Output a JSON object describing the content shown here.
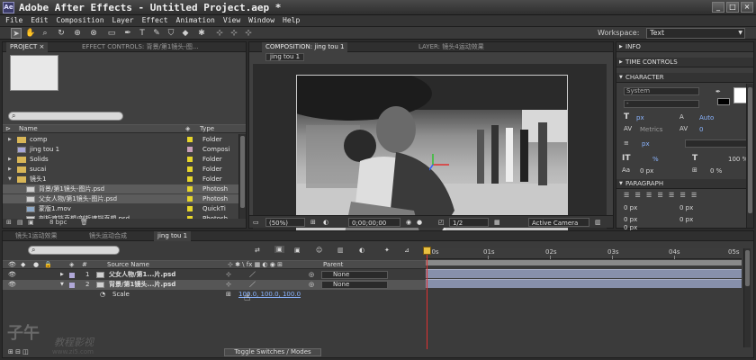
{
  "window": {
    "app_icon_text": "Ae",
    "title": "Adobe After Effects - Untitled Project.aep *",
    "controls": [
      "_",
      "□",
      "×"
    ]
  },
  "menu": [
    "File",
    "Edit",
    "Composition",
    "Layer",
    "Effect",
    "Animation",
    "View",
    "Window",
    "Help"
  ],
  "toolbar": {
    "tools": [
      "selection-tool",
      "hand-tool",
      "zoom-tool",
      "rotation-tool",
      "orbit-camera-tool",
      "pan-behind-tool",
      "rectangle-mask-tool",
      "pen-tool",
      "type-tool",
      "brush-tool",
      "clone-stamp-tool",
      "eraser-tool",
      "puppet-pin-tool",
      "local-axis-mode",
      "world-axis-mode",
      "view-axis-mode"
    ],
    "workspace_label": "Workspace:",
    "workspace_value": "Text"
  },
  "project_panel": {
    "tabs": [
      "PROJECT ×",
      "EFFECT CONTROLS: 背景/第1镜头-图..."
    ],
    "columns": {
      "name": "Name",
      "type": "Type"
    },
    "items": [
      {
        "name": "comp",
        "type": "Folder",
        "icon": "folder",
        "indent": 0,
        "expanded": false
      },
      {
        "name": "jing tou 1",
        "type": "Composi",
        "icon": "comp",
        "indent": 0,
        "expanded": null
      },
      {
        "name": "Solids",
        "type": "Folder",
        "icon": "folder",
        "indent": 0,
        "expanded": false
      },
      {
        "name": "sucai",
        "type": "Folder",
        "icon": "folder",
        "indent": 0,
        "expanded": false
      },
      {
        "name": "镜头1",
        "type": "Folder",
        "icon": "folder",
        "indent": 0,
        "expanded": true
      },
      {
        "name": "背景/第1镜头-图片.psd",
        "type": "Photosh",
        "icon": "psd",
        "indent": 1,
        "expanded": null
      },
      {
        "name": "父女人物/第1镜头-图片.psd",
        "type": "Photosh",
        "icon": "psd",
        "indent": 1,
        "expanded": null
      },
      {
        "name": "蒙版1.mov",
        "type": "QuickTi",
        "icon": "mov",
        "indent": 1,
        "expanded": null
      },
      {
        "name": "剖析遮挡直想/剖析遮挡直想.psd",
        "type": "Photosh",
        "icon": "psd",
        "indent": 1,
        "expanded": null
      }
    ],
    "footer_bpc": "8 bpc"
  },
  "composition_panel": {
    "tabs": [
      "COMPOSITION: jing tou 1",
      "LAYER: 镜头4运动效果"
    ],
    "comp_tab": "jing tou 1",
    "zoom": "(50%)",
    "timecode": "0;00;00;00",
    "resolution": "1/2",
    "camera": "Active Camera"
  },
  "right_panels": {
    "info": "INFO",
    "time_controls": "TIME CONTROLS",
    "character": {
      "title": "CHARACTER",
      "font": "System",
      "style": "-",
      "size_unit": "px",
      "leading_auto": "Auto",
      "metrics": "Metrics",
      "tracking": "0",
      "stroke_unit": "px",
      "vscale": "%",
      "hscale": "100 %",
      "baseline": "0 px",
      "tsume": "0 %"
    },
    "paragraph": {
      "title": "PARAGRAPH",
      "indents": [
        "0 px",
        "0 px",
        "0 px",
        "0 px",
        "0 px"
      ]
    }
  },
  "timeline": {
    "tabs": [
      "镜头1运动效果",
      "镜头运动合成",
      "jing tou 1"
    ],
    "columns": {
      "source": "Source Name",
      "parent": "Parent"
    },
    "layers": [
      {
        "num": "1",
        "name": "父女人物/第1...片.psd",
        "parent": "None"
      },
      {
        "num": "2",
        "name": "背景/第1镜头...片.psd",
        "parent": "None"
      }
    ],
    "property": {
      "name": "Scale",
      "value": "100.0, 100.0, 100.0"
    },
    "ruler_ticks": [
      "00s",
      "01s",
      "02s",
      "03s",
      "04s",
      "05s"
    ],
    "toggle_label": "Toggle Switches / Modes"
  },
  "watermark": {
    "main": "子午",
    "sub": "教程影视",
    "url": "www.zi5.com"
  }
}
